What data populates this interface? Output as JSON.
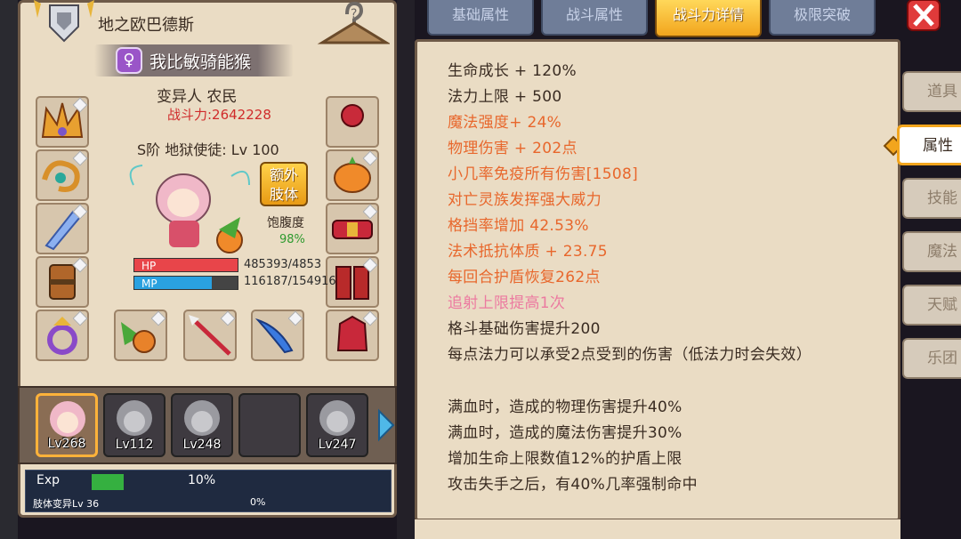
{
  "character": {
    "name": "地之欧巴德斯",
    "title": "我比敏骑能猴",
    "gender_symbol": "♀",
    "race_class": "变异人 农民",
    "power": "战斗力:2642228",
    "rank_level": "S阶 地狱使徒: Lv 100",
    "extra_limb_line1": "额外",
    "extra_limb_line2": "肢体",
    "satiety_label": "饱腹度",
    "satiety_value": "98%",
    "hp_label": "HP",
    "mp_label": "MP",
    "hp_value": "485393/4853",
    "mp_value": "116187/154916",
    "mp_fraction": 0.75
  },
  "party": [
    {
      "level": "Lv268",
      "active": true
    },
    {
      "level": "Lv112",
      "active": false
    },
    {
      "level": "Lv248",
      "active": false
    },
    {
      "level": "",
      "active": false
    },
    {
      "level": "Lv247",
      "active": false
    }
  ],
  "exp": {
    "label": "Exp",
    "percent": "10%",
    "fraction": 0.1,
    "limb_label": "肢体变异Lv 36",
    "limb_percent": "0%"
  },
  "tabs": [
    {
      "label": "基础属性",
      "active": false
    },
    {
      "label": "战斗属性",
      "active": false
    },
    {
      "label": "战斗力详情",
      "active": true
    },
    {
      "label": "极限突破",
      "active": false
    }
  ],
  "stats": [
    {
      "text": "生命成长 + 120%",
      "color": "#3a2c22"
    },
    {
      "text": "法力上限 + 500",
      "color": "#3a2c22"
    },
    {
      "text": "魔法强度+ 24%",
      "color": "#e8672c"
    },
    {
      "text": "物理伤害 + 202点",
      "color": "#e8672c"
    },
    {
      "text": "小几率免疫所有伤害[1508]",
      "color": "#e8672c"
    },
    {
      "text": "对亡灵族发挥强大威力",
      "color": "#e8672c"
    },
    {
      "text": "格挡率增加 42.53%",
      "color": "#e8672c"
    },
    {
      "text": "法术抵抗体质 + 23.75",
      "color": "#e8672c"
    },
    {
      "text": "每回合护盾恢复262点",
      "color": "#e8672c"
    },
    {
      "text": "追射上限提高1次",
      "color": "#ec7aa0"
    },
    {
      "text": "格斗基础伤害提升200",
      "color": "#3a2c22"
    },
    {
      "text": "每点法力可以承受2点受到的伤害（低法力时会失效）",
      "color": "#3a2c22"
    },
    {
      "text": "满血时，造成的物理伤害提升40%",
      "color": "#3a2c22"
    },
    {
      "text": "满血时，造成的魔法伤害提升30%",
      "color": "#3a2c22"
    },
    {
      "text": "增加生命上限数值12%的护盾上限",
      "color": "#3a2c22"
    },
    {
      "text": "攻击失手之后，有40%几率强制命中",
      "color": "#3a2c22"
    }
  ],
  "side_nav": [
    {
      "label": "道具",
      "active": false
    },
    {
      "label": "属性",
      "active": true
    },
    {
      "label": "技能",
      "active": false
    },
    {
      "label": "魔法",
      "active": false
    },
    {
      "label": "天赋",
      "active": false
    },
    {
      "label": "乐团",
      "active": false
    }
  ],
  "icons": {
    "close": "close-icon",
    "hanger": "hanger-icon",
    "emblem": "guild-emblem-icon",
    "next": "chevron-right-icon"
  }
}
